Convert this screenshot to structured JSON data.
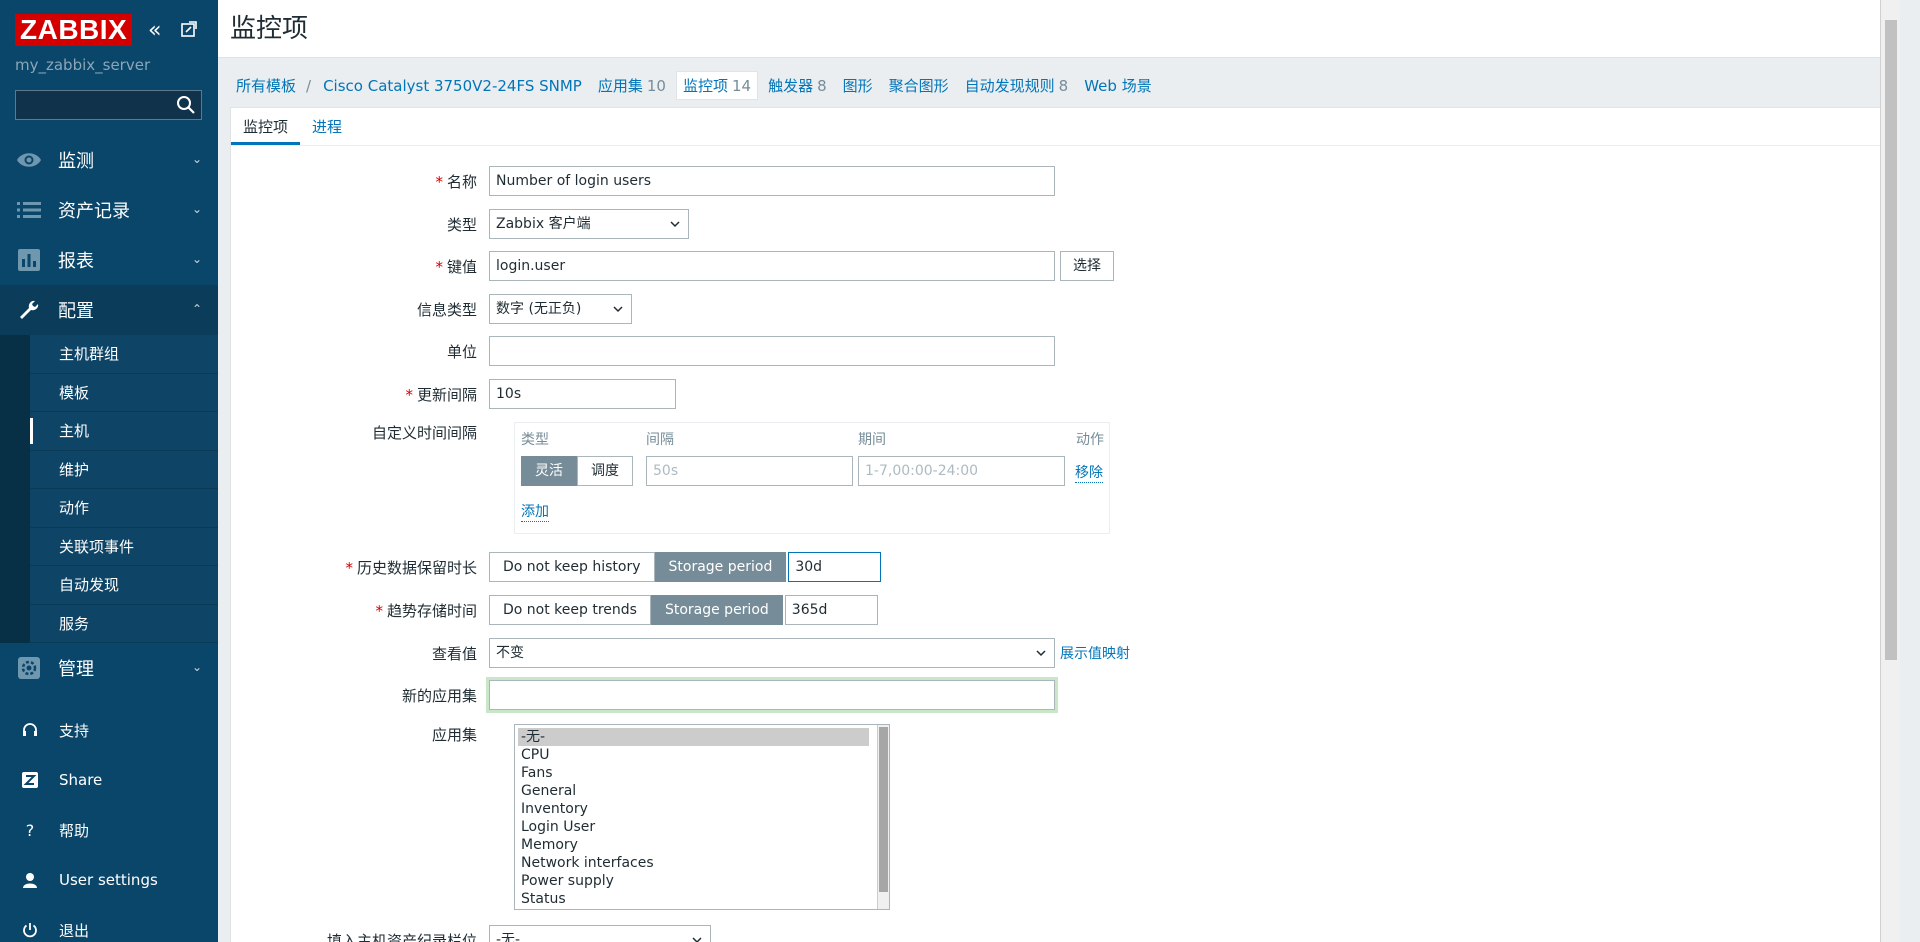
{
  "app": {
    "logo": "ZABBIX",
    "server_name": "my_zabbix_server",
    "search_placeholder": ""
  },
  "menu": {
    "items": [
      {
        "label": "监测",
        "icon": "eye-icon"
      },
      {
        "label": "资产记录",
        "icon": "list-icon"
      },
      {
        "label": "报表",
        "icon": "bar-chart-icon"
      },
      {
        "label": "配置",
        "icon": "wrench-icon"
      },
      {
        "label": "管理",
        "icon": "gear-icon"
      }
    ],
    "config_sub": [
      "主机群组",
      "模板",
      "主机",
      "维护",
      "动作",
      "关联项事件",
      "自动发现",
      "服务"
    ],
    "bottom": [
      {
        "label": "支持",
        "icon": "headset-icon"
      },
      {
        "label": "Share",
        "icon": "share-icon"
      },
      {
        "label": "帮助",
        "icon": "help-icon"
      },
      {
        "label": "User settings",
        "icon": "user-icon"
      },
      {
        "label": "退出",
        "icon": "power-icon"
      }
    ]
  },
  "header": {
    "title": "监控项"
  },
  "breadcrumbs": {
    "all_templates": "所有模板",
    "sep": "/",
    "template": "Cisco Catalyst 3750V2-24FS SNMP",
    "applications": "应用集",
    "applications_count": "10",
    "items": "监控项",
    "items_count": "14",
    "triggers": "触发器",
    "triggers_count": "8",
    "graphs": "图形",
    "screens": "聚合图形",
    "discovery": "自动发现规则",
    "discovery_count": "8",
    "web": "Web 场景"
  },
  "tabs": {
    "item": "监控项",
    "preprocessing": "进程"
  },
  "form": {
    "name_label": "名称",
    "name_value": "Number of login users",
    "type_label": "类型",
    "type_value": "Zabbix 客户端",
    "key_label": "键值",
    "key_value": "login.user",
    "key_select": "选择",
    "info_type_label": "信息类型",
    "info_type_value": "数字 (无正负)",
    "units_label": "单位",
    "units_value": "",
    "interval_label": "更新间隔",
    "interval_value": "10s",
    "custom_label": "自定义时间间隔",
    "custom_headers": {
      "type": "类型",
      "interval": "间隔",
      "period": "期间",
      "action": "动作"
    },
    "custom_flexible": "灵活",
    "custom_scheduling": "调度",
    "custom_interval_placeholder": "50s",
    "custom_period_placeholder": "1-7,00:00-24:00",
    "custom_remove": "移除",
    "custom_add": "添加",
    "history_label": "历史数据保留时长",
    "history_no": "Do not keep history",
    "history_storage": "Storage period",
    "history_value": "30d",
    "trends_label": "趋势存储时间",
    "trends_no": "Do not keep trends",
    "trends_storage": "Storage period",
    "trends_value": "365d",
    "valuemap_label": "查看值",
    "valuemap_value": "不变",
    "valuemap_link": "展示值映射",
    "new_app_label": "新的应用集",
    "new_app_value": "",
    "apps_label": "应用集",
    "apps": [
      "-无-",
      "CPU",
      "Fans",
      "General",
      "Inventory",
      "Login User",
      "Memory",
      "Network interfaces",
      "Power supply",
      "Status"
    ],
    "inventory_label": "填入主机资产纪录栏位",
    "inventory_value": "-无-"
  }
}
